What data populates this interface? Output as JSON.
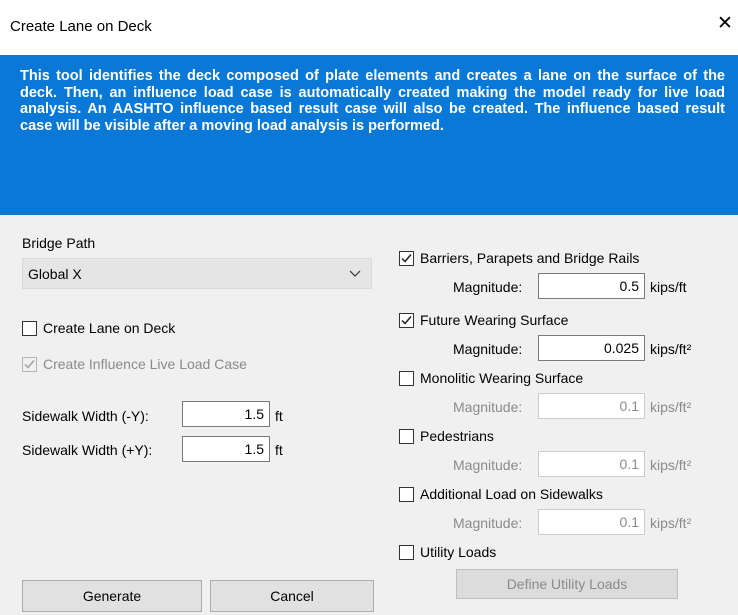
{
  "window": {
    "title": "Create Lane on Deck",
    "close_glyph": "✕"
  },
  "banner": {
    "text": "This tool identifies the deck composed of plate elements and creates a lane on the surface of the deck. Then,  an influence load case is automatically created making the model ready for live load analysis. An AASHTO influence based result case will also be created. The influence based result case will be visible after a moving load analysis is performed.",
    "color": "#0a78d7"
  },
  "left": {
    "bridge_path_label": "Bridge Path",
    "bridge_path_value": "Global X",
    "create_lane_label": "Create Lane on Deck",
    "create_lane_checked": false,
    "create_influence_label": "Create Influence Live Load Case",
    "create_influence_checked": true,
    "sidewalk_neg_label": "Sidewalk Width (-Y):",
    "sidewalk_neg_value": "1.5",
    "sidewalk_neg_unit": "ft",
    "sidewalk_pos_label": "Sidewalk Width (+Y):",
    "sidewalk_pos_value": "1.5",
    "sidewalk_pos_unit": "ft"
  },
  "right": {
    "magnitude_label": "Magnitude:",
    "loads": [
      {
        "label": "Barriers, Parapets and Bridge Rails",
        "checked": true,
        "value": "0.5",
        "unit": "kips/ft"
      },
      {
        "label": "Future Wearing Surface",
        "checked": true,
        "value": "0.025",
        "unit": "kips/ft²"
      },
      {
        "label": "Monolitic Wearing Surface",
        "checked": false,
        "value": "0.1",
        "unit": "kips/ft²"
      },
      {
        "label": "Pedestrians",
        "checked": false,
        "value": "0.1",
        "unit": "kips/ft²"
      },
      {
        "label": "Additional Load on Sidewalks",
        "checked": false,
        "value": "0.1",
        "unit": "kips/ft²"
      }
    ],
    "utility_label": "Utility Loads",
    "utility_checked": false,
    "define_utility_label": "Define Utility Loads"
  },
  "buttons": {
    "generate": "Generate",
    "cancel": "Cancel"
  }
}
